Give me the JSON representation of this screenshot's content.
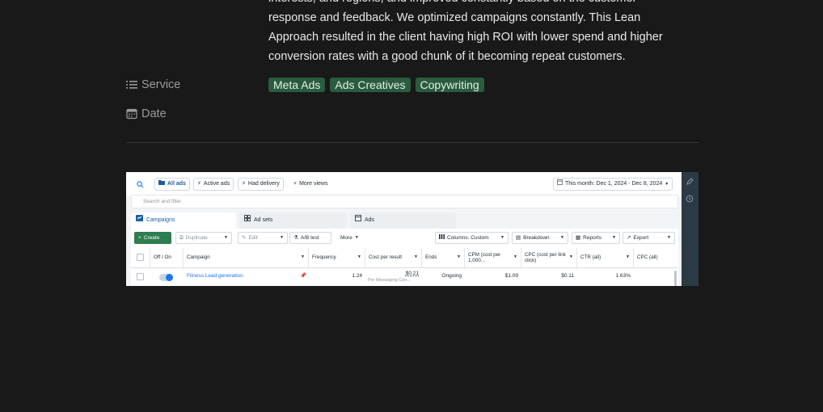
{
  "description": {
    "lines": [
      "interests, and regions, and improved constantly based on the customer",
      "response and feedback. We optimized campaigns constantly. This Lean",
      "Approach resulted in the client having high ROI with lower spend and higher",
      "conversion rates with a good chunk of it becoming repeat customers."
    ]
  },
  "properties": {
    "service_label": "Service",
    "service_tags": [
      "Meta Ads",
      "Ads Creatives",
      "Copywriting"
    ],
    "date_label": "Date",
    "tag_color": "#2b5b3e"
  },
  "screenshot": {
    "topbar": {
      "all_ads": "All ads",
      "active_ads": "Active ads",
      "had_delivery": "Had delivery",
      "more_views": "More views",
      "date_range": "This month: Dec 1, 2024 - Dec 8, 2024"
    },
    "search_placeholder": "Search and filter",
    "tabs": [
      "Campaigns",
      "Ad sets",
      "Ads"
    ],
    "toolbar": {
      "create": "Create",
      "duplicate": "Duplicate",
      "edit": "Edit",
      "ab_test": "A/B test",
      "more": "More",
      "columns": "Columns: Custom",
      "breakdown": "Breakdown",
      "reports": "Reports",
      "export": "Export"
    },
    "headers": {
      "off_on": "Off / On",
      "campaign": "Campaign",
      "frequency": "Frequency",
      "cost_per_result": "Cost per result",
      "ends": "Ends",
      "cpm": "CPM (cost per 1,000...",
      "cpc_link": "CPC (cost per link click)",
      "ctr": "CTR (all)",
      "cpc_all": "CPC (all)"
    },
    "row": {
      "campaign": "Fitness Lead generation",
      "frequency": "1.24",
      "cost_per_result": "$0.21",
      "cost_per_result_sub": "Per Messaging Con...",
      "ends": "Ongoing",
      "cpm": "$1.09",
      "cpc_link": "$0.11",
      "ctr": "1.63%"
    },
    "accent_color": "#1877f2",
    "create_color": "#2e7d4f"
  }
}
